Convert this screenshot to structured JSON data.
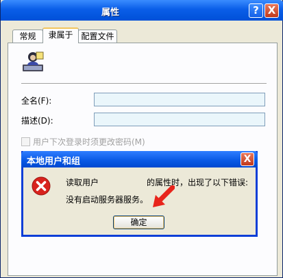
{
  "window": {
    "title": "属性",
    "help_label": "?",
    "close_label": "X"
  },
  "tabs": [
    {
      "label": "常规",
      "active": false
    },
    {
      "label": "隶属于",
      "active": true
    },
    {
      "label": "配置文件",
      "active": false
    }
  ],
  "form": {
    "fullname_label": "全名(F):",
    "fullname_value": "",
    "description_label": "描述(D):",
    "description_value": "",
    "checkbox_label": "用户下次登录时须更改密码(M)",
    "checkbox_checked": false
  },
  "dialog": {
    "title": "本地用户和组",
    "close_label": "X",
    "message_part1": "读取用户",
    "message_part2": "的属性时，出现了以下错误:",
    "message_line2": "没有启动服务器服务。",
    "ok_label": "确定"
  },
  "icons": {
    "user": "user-icon",
    "error": "error-icon",
    "annotation": "red-arrow-icon"
  },
  "colors": {
    "titlebar": "#0A5EE8",
    "input_bg": "#EAF6FB",
    "error_red": "#D8231D",
    "arrow_red": "#E8241B"
  }
}
